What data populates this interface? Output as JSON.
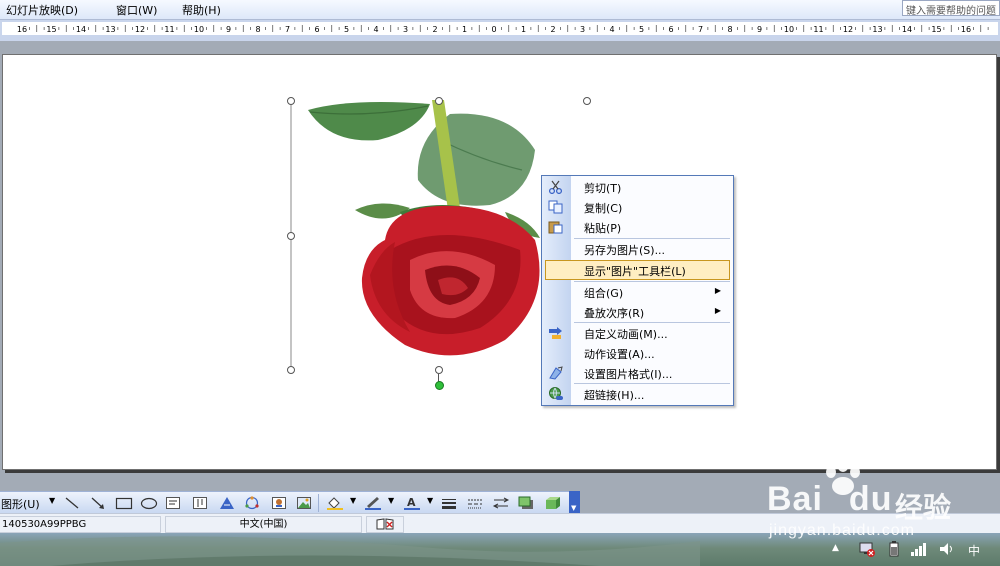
{
  "menubar": {
    "items": [
      "幻灯片放映(D)",
      "窗口(W)",
      "帮助(H)"
    ],
    "help_placeholder": "键入需要帮助的问题"
  },
  "ruler": {
    "labels": [
      "16",
      "15",
      "14",
      "13",
      "12",
      "11",
      "10",
      "9",
      "8",
      "7",
      "6",
      "5",
      "4",
      "3",
      "2",
      "1",
      "0",
      "1",
      "2",
      "3",
      "4",
      "5",
      "6",
      "7",
      "8",
      "9",
      "10",
      "11",
      "12",
      "13",
      "14",
      "15",
      "16"
    ]
  },
  "context_menu": {
    "items": [
      {
        "label": "剪切(T)",
        "icon": "scissors-icon"
      },
      {
        "label": "复制(C)",
        "icon": "copy-icon"
      },
      {
        "label": "粘贴(P)",
        "icon": "paste-icon"
      },
      {
        "label": "另存为图片(S)...",
        "icon": ""
      },
      {
        "label": "显示\"图片\"工具栏(L)",
        "icon": "",
        "highlighted": true
      },
      {
        "label": "组合(G)",
        "icon": "",
        "submenu": true
      },
      {
        "label": "叠放次序(R)",
        "icon": "",
        "submenu": true
      },
      {
        "label": "自定义动画(M)...",
        "icon": "animation-icon"
      },
      {
        "label": "动作设置(A)...",
        "icon": ""
      },
      {
        "label": "设置图片格式(I)...",
        "icon": "format-picture-icon"
      },
      {
        "label": "超链接(H)...",
        "icon": "hyperlink-icon"
      }
    ]
  },
  "drawbar": {
    "shapes_label": "图形(U)"
  },
  "status": {
    "document": "140530A99PPBG",
    "language": "中文(中国)"
  },
  "taskbar": {
    "ime": "中"
  },
  "watermark": {
    "brand": "Bai",
    "brand2": "du",
    "cn": "经验",
    "url": "jingyan.baidu.com"
  },
  "colors": {
    "accent": "#3a64c6",
    "highlight": "#ffeec2",
    "rose": "#c81e2a",
    "leaf": "#4f8a4a"
  }
}
